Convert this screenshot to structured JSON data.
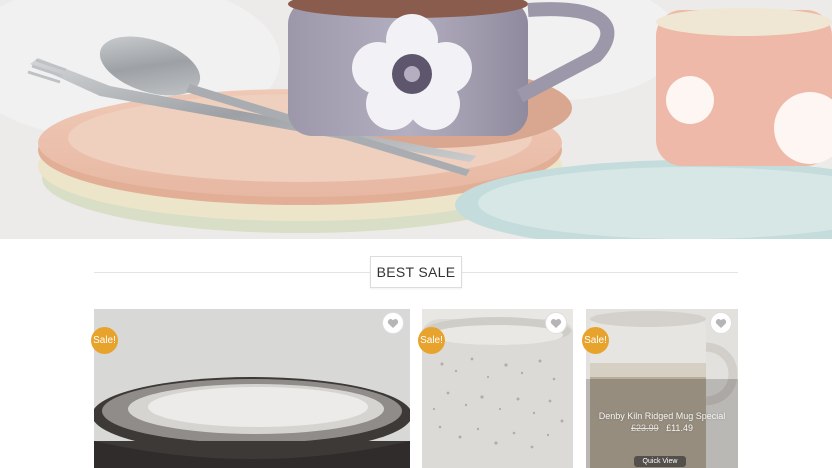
{
  "hero": {
    "image": "tableware-set-with-floral-mugs-and-cutlery"
  },
  "section": {
    "title": "BEST SALE"
  },
  "products": [
    {
      "badge": "Sale!",
      "wishlist_icon": "heart-icon",
      "image": "dark-ceramic-bowl"
    },
    {
      "badge": "Sale!",
      "wishlist_icon": "heart-icon",
      "image": "speckled-glaze-mug"
    },
    {
      "badge": "Sale!",
      "wishlist_icon": "heart-icon",
      "image": "kiln-ridged-mug",
      "name": "Denby Kiln Ridged Mug Special",
      "old_price": "£23.99",
      "price": "£11.49",
      "quick_view": "Quick View"
    }
  ],
  "colors": {
    "sale_badge": "#e8a32d",
    "heading_text": "#333333",
    "rule": "#e4e4e4"
  }
}
